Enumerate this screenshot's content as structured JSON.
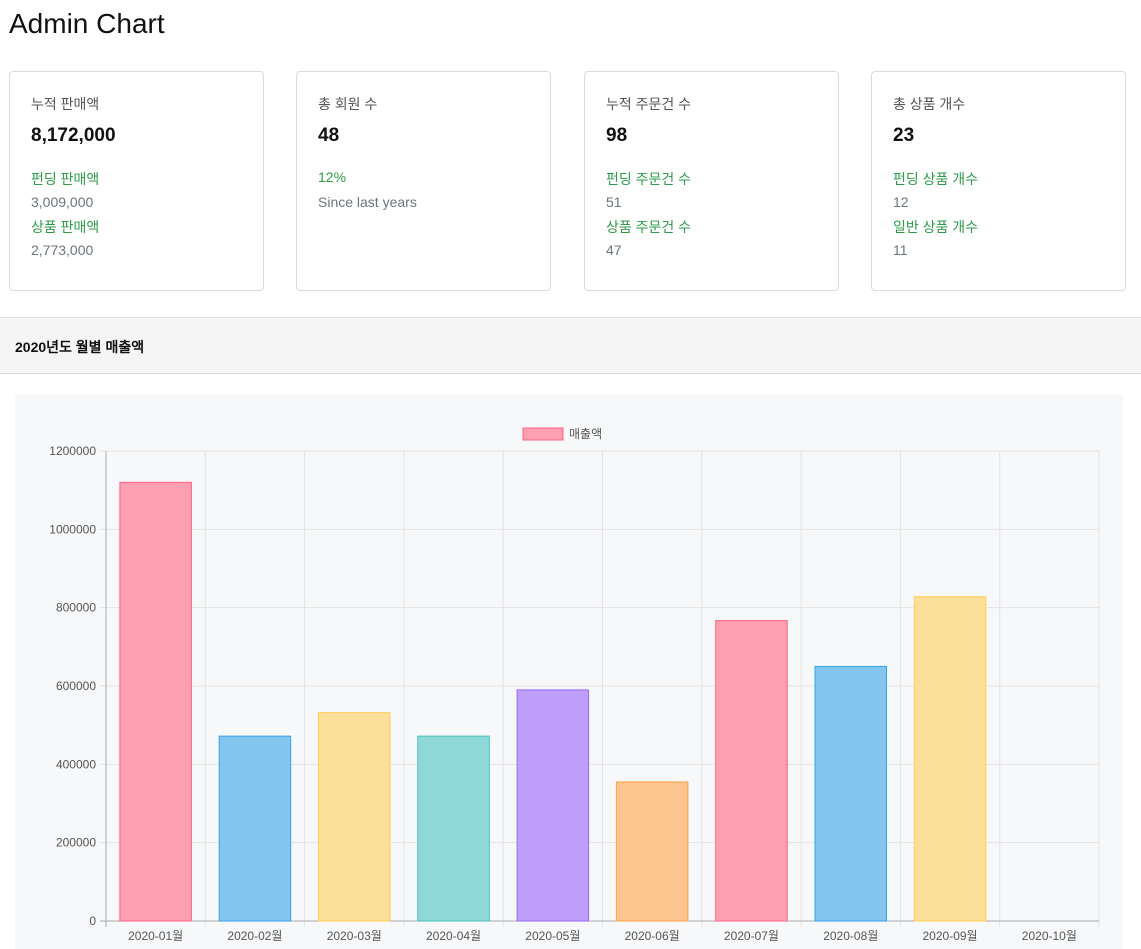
{
  "page": {
    "title": "Admin Chart"
  },
  "cards": [
    {
      "title": "누적 판매액",
      "value": "8,172,000",
      "sub1_label": "펀딩 판매액",
      "sub1_value": "3,009,000",
      "sub2_label": "상품 판매액",
      "sub2_value": "2,773,000"
    },
    {
      "title": "총 회원 수",
      "value": "48",
      "sub1_label": "12%",
      "sub1_value": "Since last years",
      "sub2_label": "",
      "sub2_value": ""
    },
    {
      "title": "누적 주문건 수",
      "value": "98",
      "sub1_label": "펀딩 주문건 수",
      "sub1_value": "51",
      "sub2_label": "상품 주문건 수",
      "sub2_value": "47"
    },
    {
      "title": "총 상품 개수",
      "value": "23",
      "sub1_label": "펀딩 상품 개수",
      "sub1_value": "12",
      "sub2_label": "일반 상품 개수",
      "sub2_value": "11"
    }
  ],
  "section": {
    "title": "2020년도 월별 매출액"
  },
  "chart_data": {
    "type": "bar",
    "title": "",
    "xlabel": "",
    "ylabel": "",
    "legend": {
      "position": "top-center",
      "labels": [
        "매출액"
      ]
    },
    "grid": true,
    "categories": [
      "2020-01월",
      "2020-02월",
      "2020-03월",
      "2020-04월",
      "2020-05월",
      "2020-06월",
      "2020-07월",
      "2020-08월",
      "2020-09월",
      "2020-10월"
    ],
    "series": [
      {
        "name": "매출액",
        "values": [
          1120000,
          472000,
          532000,
          472000,
          590000,
          355000,
          767000,
          650000,
          828000,
          0
        ]
      }
    ],
    "ylim": [
      0,
      1200000
    ],
    "yticks": [
      0,
      200000,
      400000,
      600000,
      800000,
      1000000,
      1200000
    ],
    "colors": {
      "fills": [
        "#ff9fb2",
        "#84c5f0",
        "#fcdf99",
        "#8ed8d8",
        "#bea0fb",
        "#fcc58f",
        "#ff9fb2",
        "#84c5f0",
        "#fcdf99",
        "#8ed8d8"
      ],
      "strokes": [
        "#ff6384",
        "#36a2eb",
        "#ffcd56",
        "#4bc0c0",
        "#9966ff",
        "#ff9f40",
        "#ff6384",
        "#36a2eb",
        "#ffcd56",
        "#4bc0c0"
      ],
      "grid": "#e4e4e4",
      "axis": "#aaaaaa",
      "tick_text": "#555555"
    }
  }
}
